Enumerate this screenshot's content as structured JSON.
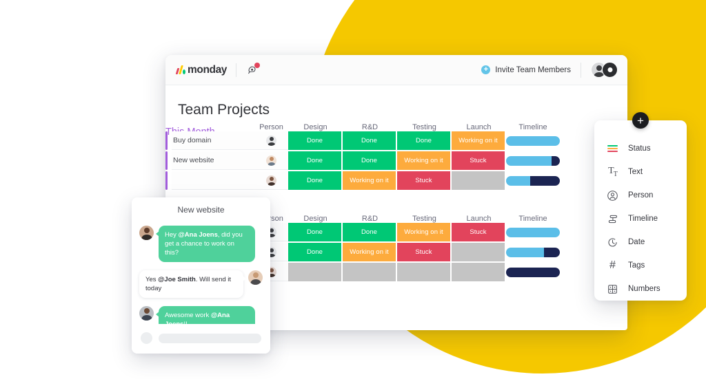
{
  "decor": {
    "circle_color": "#F5C800"
  },
  "app": {
    "logo_text": "monday",
    "notification_icon": "bell-icon",
    "invite_label": "Invite Team Members",
    "board_title": "Team Projects"
  },
  "board": {
    "groups": [
      {
        "name": "This Month",
        "group_color": "#A25DDC",
        "columns": [
          "Person",
          "Design",
          "R&D",
          "Testing",
          "Launch",
          "Timeline"
        ],
        "rows": [
          {
            "name": "Buy domain",
            "avatar": "dark",
            "design": "Done",
            "rnd": "Done",
            "testing": "Done",
            "launch": "Working on it",
            "timeline": {
              "blue_pct": 100,
              "navy_pct": 0
            }
          },
          {
            "name": "New website",
            "avatar": "tan",
            "design": "Done",
            "rnd": "Done",
            "testing": "Working on it",
            "launch": "Stuck",
            "timeline": {
              "blue_pct": 84,
              "navy_pct": 16
            }
          },
          {
            "name": "",
            "avatar": "brun",
            "design": "Done",
            "rnd": "Working on it",
            "testing": "Stuck",
            "launch": "",
            "timeline": {
              "blue_pct": 45,
              "navy_pct": 55
            }
          }
        ]
      },
      {
        "name": "",
        "group_color": "#A25DDC",
        "columns": [
          "Person",
          "Design",
          "R&D",
          "Testing",
          "Launch",
          "Timeline"
        ],
        "rows": [
          {
            "name": "",
            "avatar": "dark",
            "design": "Done",
            "rnd": "Done",
            "testing": "Working on it",
            "launch": "Stuck",
            "timeline": {
              "blue_pct": 100,
              "navy_pct": 0
            }
          },
          {
            "name": "",
            "avatar": "dark",
            "design": "Done",
            "rnd": "Working on it",
            "testing": "Stuck",
            "launch": "",
            "timeline": {
              "blue_pct": 70,
              "navy_pct": 30
            }
          },
          {
            "name": "",
            "avatar": "brun",
            "design": "",
            "rnd": "",
            "testing": "",
            "launch": "",
            "timeline": {
              "blue_pct": 0,
              "navy_pct": 100
            }
          }
        ]
      }
    ],
    "status_colors": {
      "done": "#00C875",
      "working": "#FDAB3D",
      "stuck": "#E2445C",
      "empty": "#C4C4C4",
      "timeline_blue": "#5BBEE8",
      "timeline_navy": "#1B2452"
    }
  },
  "chat": {
    "title": "New website",
    "messages": [
      {
        "side": "left",
        "mention": "@Ana Joens",
        "before": "Hey ",
        "after": ", did you get a chance to work on this?"
      },
      {
        "side": "right",
        "mention": "@Joe Smith",
        "before": "Yes ",
        "after": ". Will send it today"
      },
      {
        "side": "left",
        "mention": "@Ana Joens",
        "before": "Awesome work ",
        "after": "!!"
      }
    ],
    "composer_placeholder": ""
  },
  "column_menu": {
    "add_button_icon": "plus-icon",
    "items": [
      {
        "icon": "status-icon",
        "label": "Status"
      },
      {
        "icon": "text-icon",
        "label": "Text"
      },
      {
        "icon": "person-icon",
        "label": "Person"
      },
      {
        "icon": "timeline-icon",
        "label": "Timeline"
      },
      {
        "icon": "date-icon",
        "label": "Date"
      },
      {
        "icon": "tags-icon",
        "label": "Tags"
      },
      {
        "icon": "numbers-icon",
        "label": "Numbers"
      }
    ]
  }
}
